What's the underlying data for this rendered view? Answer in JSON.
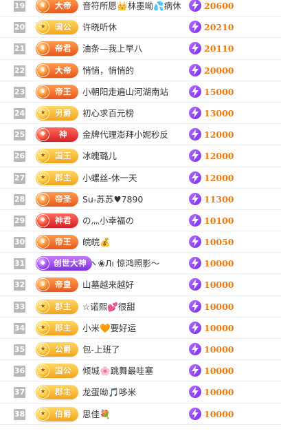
{
  "ranking": {
    "rows": [
      {
        "rank": "19",
        "badge": "大帝",
        "name": "音符所愿👑林墨呦💦病休",
        "points": "20600"
      },
      {
        "rank": "20",
        "badge": "国公",
        "name": "许晓听休",
        "points": "20210"
      },
      {
        "rank": "21",
        "badge": "帝君",
        "name": "油条—我上早八",
        "points": "20110"
      },
      {
        "rank": "22",
        "badge": "大帝",
        "name": "悄悄，悄悄的",
        "points": "20000"
      },
      {
        "rank": "23",
        "badge": "帝王",
        "name": "小朝阳走遍山河湖南站",
        "points": "15000"
      },
      {
        "rank": "24",
        "badge": "男爵",
        "name": "初心求百元榜",
        "points": "13000"
      },
      {
        "rank": "25",
        "badge": "神",
        "name": "金牌代理澎拜小妮秒反",
        "points": "12000"
      },
      {
        "rank": "26",
        "badge": "国王",
        "name": "冰魄璐儿",
        "points": "12000"
      },
      {
        "rank": "27",
        "badge": "郡主",
        "name": "小螺丝-休一天",
        "points": "12000"
      },
      {
        "rank": "28",
        "badge": "帝圣",
        "name": "Su-苏苏♥7890",
        "points": "11300"
      },
      {
        "rank": "29",
        "badge": "神君",
        "name": "の灬小幸福の",
        "points": "10100"
      },
      {
        "rank": "30",
        "badge": "帝王",
        "name": "皖皖💰",
        "points": "10050"
      },
      {
        "rank": "31",
        "badge": "创世大神",
        "name": "ヽ❀Лı 惊鸿照影～",
        "points": "10000"
      },
      {
        "rank": "32",
        "badge": "帝皇",
        "name": "山墓越来越好",
        "points": "10000"
      },
      {
        "rank": "33",
        "badge": "郡主",
        "name": "☆诺熙💕很甜",
        "points": "10000"
      },
      {
        "rank": "34",
        "badge": "郡主",
        "name": "小米🧡要好运",
        "points": "10000"
      },
      {
        "rank": "35",
        "badge": "公爵",
        "name": "包-上班了",
        "points": "10000"
      },
      {
        "rank": "36",
        "badge": "国公",
        "name": "倾城🌸跳舞最哇塞",
        "points": "10000"
      },
      {
        "rank": "37",
        "badge": "郡主",
        "name": "龙蛋呦🎵哆米",
        "points": "10000"
      },
      {
        "rank": "38",
        "badge": "伯爵",
        "name": "思佳💐",
        "points": "10000"
      }
    ]
  },
  "colors": {
    "points": "#f07a10",
    "rank_bg": "#b9b9b9",
    "bolt": "#8a3cf0"
  },
  "icons": {
    "points_icon": "lightning-bolt-icon",
    "badge_emblem": "rank-emblem-icon"
  }
}
